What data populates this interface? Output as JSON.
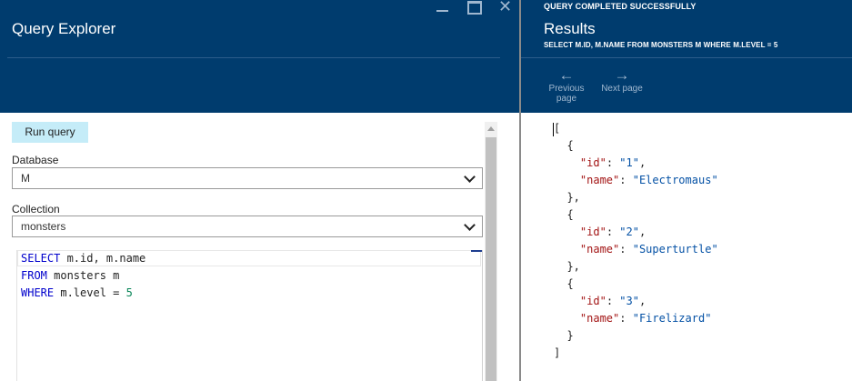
{
  "window": {
    "minimize": "—",
    "maximize": "□",
    "close": "✕"
  },
  "explorer": {
    "title": "Query Explorer",
    "run_button": "Run query",
    "database": {
      "label": "Database",
      "value": "M"
    },
    "collection": {
      "label": "Collection",
      "value": "monsters"
    },
    "query_lines": [
      {
        "kw": "SELECT",
        "rest": " m.id, m.name",
        "num": ""
      },
      {
        "kw": "FROM",
        "rest": " monsters m",
        "num": ""
      },
      {
        "kw": "WHERE",
        "rest": " m.level = ",
        "num": "5"
      }
    ]
  },
  "results": {
    "status": "QUERY COMPLETED SUCCESSFULLY",
    "title": "Results",
    "query_text": "SELECT M.ID, M.NAME FROM MONSTERS M WHERE M.LEVEL = 5",
    "prev_label": "Previous page",
    "prev_line1": "Previous",
    "prev_line2": "page",
    "next_label": "Next page",
    "items": [
      {
        "id": "1",
        "name": "Electromaus"
      },
      {
        "id": "2",
        "name": "Superturtle"
      },
      {
        "id": "3",
        "name": "Firelizard"
      }
    ]
  },
  "colors": {
    "header_bg": "#003c6e",
    "run_button_bg": "#c5ecf8",
    "json_key": "#a31515",
    "json_string": "#0451a5",
    "sql_keyword": "#0000cc",
    "sql_number": "#098658"
  },
  "icons": {
    "prev": "arrow-left-icon",
    "next": "arrow-right-icon",
    "select": "chevron-down-icon"
  }
}
